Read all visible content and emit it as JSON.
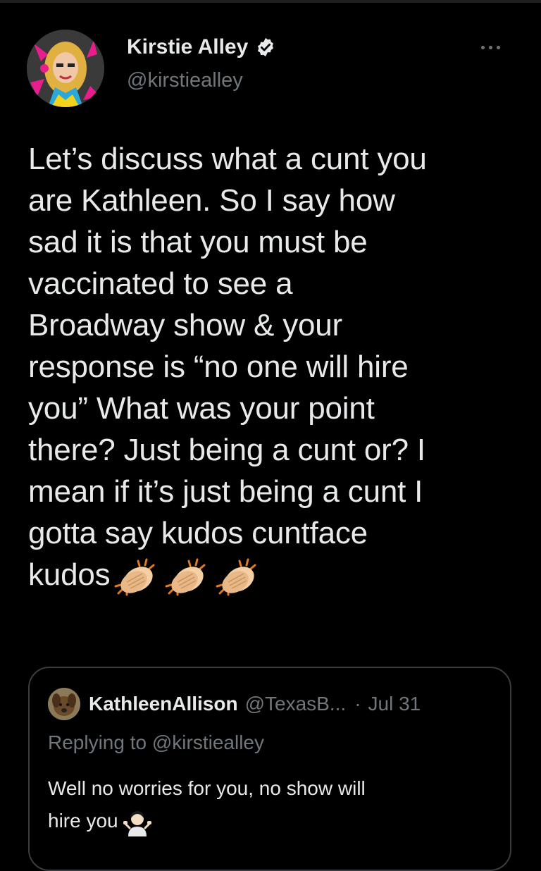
{
  "author": {
    "display_name": "Kirstie Alley",
    "handle": "@kirstiealley",
    "verified": true,
    "avatar_icon": "profile-avatar-pop-art"
  },
  "menu": {
    "more_icon": "more-horizontal-icon"
  },
  "tweet": {
    "lines": [
      "Let’s discuss what a cunt you",
      "are Kathleen. So I say how",
      "sad it is that you must be",
      "vaccinated to see a",
      "Broadway show & your",
      "response is “no one will hire",
      "you” What was your point",
      "there? Just being a cunt or? I",
      "mean if it’s just being a cunt I",
      "gotta say kudos cuntface",
      "kudos"
    ],
    "emoji": [
      "clapping-hands-icon",
      "clapping-hands-icon",
      "clapping-hands-icon"
    ]
  },
  "quoted_tweet": {
    "display_name": "KathleenAllison",
    "handle": "@TexasB...",
    "separator": "·",
    "date": "Jul 31",
    "replying_prefix": "Replying to",
    "replying_to": "@kirstiealley",
    "body_lines": [
      "Well no worries for you, no show will",
      "hire you"
    ],
    "emoji": "person-shrugging-icon"
  },
  "colors": {
    "background": "#000000",
    "text_primary": "#e7e9ea",
    "text_secondary": "#71767b",
    "border": "#3a3d40"
  }
}
